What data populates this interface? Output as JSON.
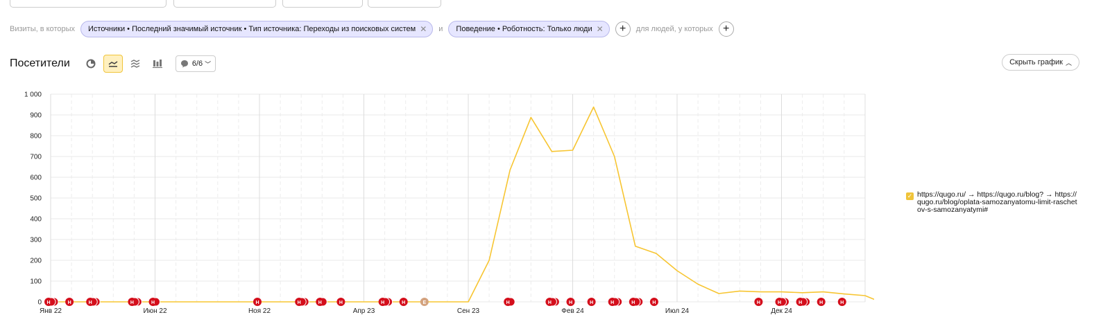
{
  "filters": {
    "prefix": "Визиты, в которых",
    "chip1": "Источники • Последний значимый источник • Тип источника: Переходы из поисковых систем",
    "connector": "и",
    "chip2": "Поведение • Роботность: Только люди",
    "people_label": "для людей, у которых"
  },
  "toolbar": {
    "title": "Посетители",
    "annotations_count": "6/6",
    "hide_chart": "Скрыть график"
  },
  "icons": {
    "close": "close-icon",
    "plus": "plus-icon",
    "pie": "pie-chart-icon",
    "line": "line-chart-icon",
    "area": "area-chart-icon",
    "bar": "bar-chart-icon",
    "comment": "comment-icon",
    "chevron": "chevron-down-icon"
  },
  "colors": {
    "series": "#f7c531",
    "grid": "#e8e8e8",
    "marker": "#d40f1c",
    "marker_alt": "#d3a27e"
  },
  "legend": {
    "checked": true,
    "label": "https://qugo.ru/ → https://qugo.ru/blog? → https://qugo.ru/blog/oplata-samozanyatomu-limit-raschetov-s-samozanyatymi#"
  },
  "chart_data": {
    "type": "line",
    "x_ticks": [
      "Янв 22",
      "Июн 22",
      "Ноя 22",
      "Апр 23",
      "Сен 23",
      "Фев 24",
      "Июл 24",
      "Дек 24"
    ],
    "y_ticks": [
      "0",
      "100",
      "200",
      "300",
      "400",
      "500",
      "600",
      "700",
      "800",
      "900",
      "1 000"
    ],
    "ylim": [
      0,
      1000
    ],
    "xlim_months": [
      0,
      39
    ],
    "grid": true,
    "legend_position": "right",
    "series": [
      {
        "name": "https://qugo.ru/ → https://qugo.ru/blog? → https://qugo.ru/blog/oplata-samozanyatomu-limit-raschetov-s-samozanyatymi#",
        "x_months": [
          0,
          1,
          2,
          3,
          4,
          5,
          6,
          7,
          8,
          9,
          10,
          11,
          12,
          13,
          14,
          15,
          16,
          17,
          18,
          19,
          20,
          21,
          22,
          23,
          24,
          25,
          26,
          27,
          28,
          29,
          30,
          31,
          32,
          33,
          34,
          35,
          36,
          37,
          38,
          39
        ],
        "values": [
          0,
          0,
          0,
          0,
          0,
          0,
          0,
          0,
          0,
          0,
          0,
          0,
          0,
          0,
          0,
          0,
          0,
          0,
          0,
          0,
          0,
          200,
          635,
          888,
          724,
          730,
          938,
          700,
          268,
          233,
          150,
          85,
          40,
          52,
          48,
          48,
          44,
          48,
          38,
          30
        ]
      }
    ],
    "annotation_markers": [
      {
        "x_months": 0,
        "count": 3,
        "label": "Н"
      },
      {
        "x_months": 1,
        "count": 1,
        "label": "Н"
      },
      {
        "x_months": 2,
        "count": 3,
        "label": "Н"
      },
      {
        "x_months": 4,
        "count": 3,
        "label": "Н"
      },
      {
        "x_months": 5,
        "count": 2,
        "label": "Н"
      },
      {
        "x_months": 10,
        "count": 1,
        "label": "Н"
      },
      {
        "x_months": 12,
        "count": 3,
        "label": "Н"
      },
      {
        "x_months": 13,
        "count": 2,
        "label": "Н"
      },
      {
        "x_months": 14,
        "count": 1,
        "label": "Н"
      },
      {
        "x_months": 16,
        "count": 3,
        "label": "Н"
      },
      {
        "x_months": 17,
        "count": 1,
        "label": "Н"
      },
      {
        "x_months": 18,
        "count": 1,
        "label": "Е",
        "alt": true
      },
      {
        "x_months": 22,
        "count": 2,
        "label": "Н"
      },
      {
        "x_months": 24,
        "count": 3,
        "label": "Н"
      },
      {
        "x_months": 25,
        "count": 1,
        "label": "Н"
      },
      {
        "x_months": 26,
        "count": 1,
        "label": "Н"
      },
      {
        "x_months": 27,
        "count": 3,
        "label": "Н"
      },
      {
        "x_months": 28,
        "count": 3,
        "label": "Н"
      },
      {
        "x_months": 29,
        "count": 1,
        "label": "Н"
      },
      {
        "x_months": 34,
        "count": 1,
        "label": "Н"
      },
      {
        "x_months": 35,
        "count": 3,
        "label": "Н"
      },
      {
        "x_months": 36,
        "count": 3,
        "label": "Н"
      },
      {
        "x_months": 37,
        "count": 1,
        "label": "Н"
      },
      {
        "x_months": 38,
        "count": 1,
        "label": "Н"
      }
    ]
  }
}
